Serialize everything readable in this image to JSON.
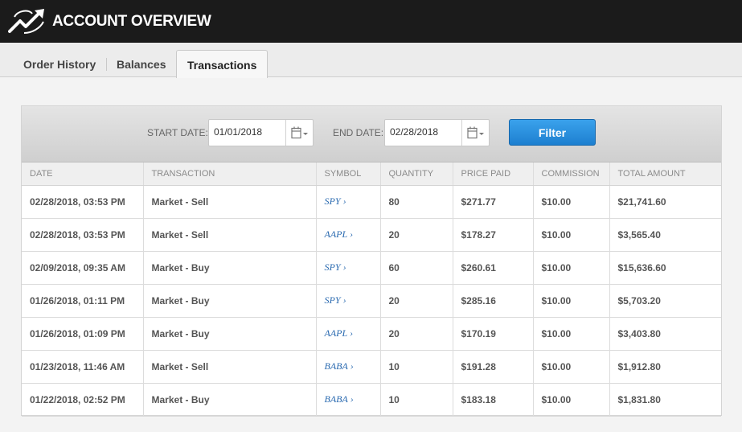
{
  "header": {
    "title": "ACCOUNT OVERVIEW",
    "logo_icon": "growth-arrow-logo-icon"
  },
  "tabs": [
    {
      "label": "Order History",
      "active": false
    },
    {
      "label": "Balances",
      "active": false
    },
    {
      "label": "Transactions",
      "active": true
    }
  ],
  "filter": {
    "start_label": "START DATE:",
    "start_value": "01/01/2018",
    "end_label": "END DATE:",
    "end_value": "02/28/2018",
    "button_label": "Filter",
    "calendar_icon": "calendar-icon"
  },
  "table": {
    "columns": [
      "DATE",
      "TRANSACTION",
      "SYMBOL",
      "QUANTITY",
      "PRICE PAID",
      "COMMISSION",
      "TOTAL AMOUNT"
    ],
    "rows": [
      [
        "02/28/2018, 03:53 PM",
        "Market - Sell",
        "SPY ›",
        "80",
        "$271.77",
        "$10.00",
        "$21,741.60"
      ],
      [
        "02/28/2018, 03:53 PM",
        "Market - Sell",
        "AAPL ›",
        "20",
        "$178.27",
        "$10.00",
        "$3,565.40"
      ],
      [
        "02/09/2018, 09:35 AM",
        "Market - Buy",
        "SPY ›",
        "60",
        "$260.61",
        "$10.00",
        "$15,636.60"
      ],
      [
        "01/26/2018, 01:11 PM",
        "Market - Buy",
        "SPY ›",
        "20",
        "$285.16",
        "$10.00",
        "$5,703.20"
      ],
      [
        "01/26/2018, 01:09 PM",
        "Market - Buy",
        "AAPL ›",
        "20",
        "$170.19",
        "$10.00",
        "$3,403.80"
      ],
      [
        "01/23/2018, 11:46 AM",
        "Market - Sell",
        "BABA ›",
        "10",
        "$191.28",
        "$10.00",
        "$1,912.80"
      ],
      [
        "01/22/2018, 02:52 PM",
        "Market - Buy",
        "BABA ›",
        "10",
        "$183.18",
        "$10.00",
        "$1,831.80"
      ]
    ]
  },
  "colors": {
    "header_bg": "#1b1b1b",
    "filter_button": "#2a8fe0",
    "symbol_link": "#2a6ab0"
  }
}
